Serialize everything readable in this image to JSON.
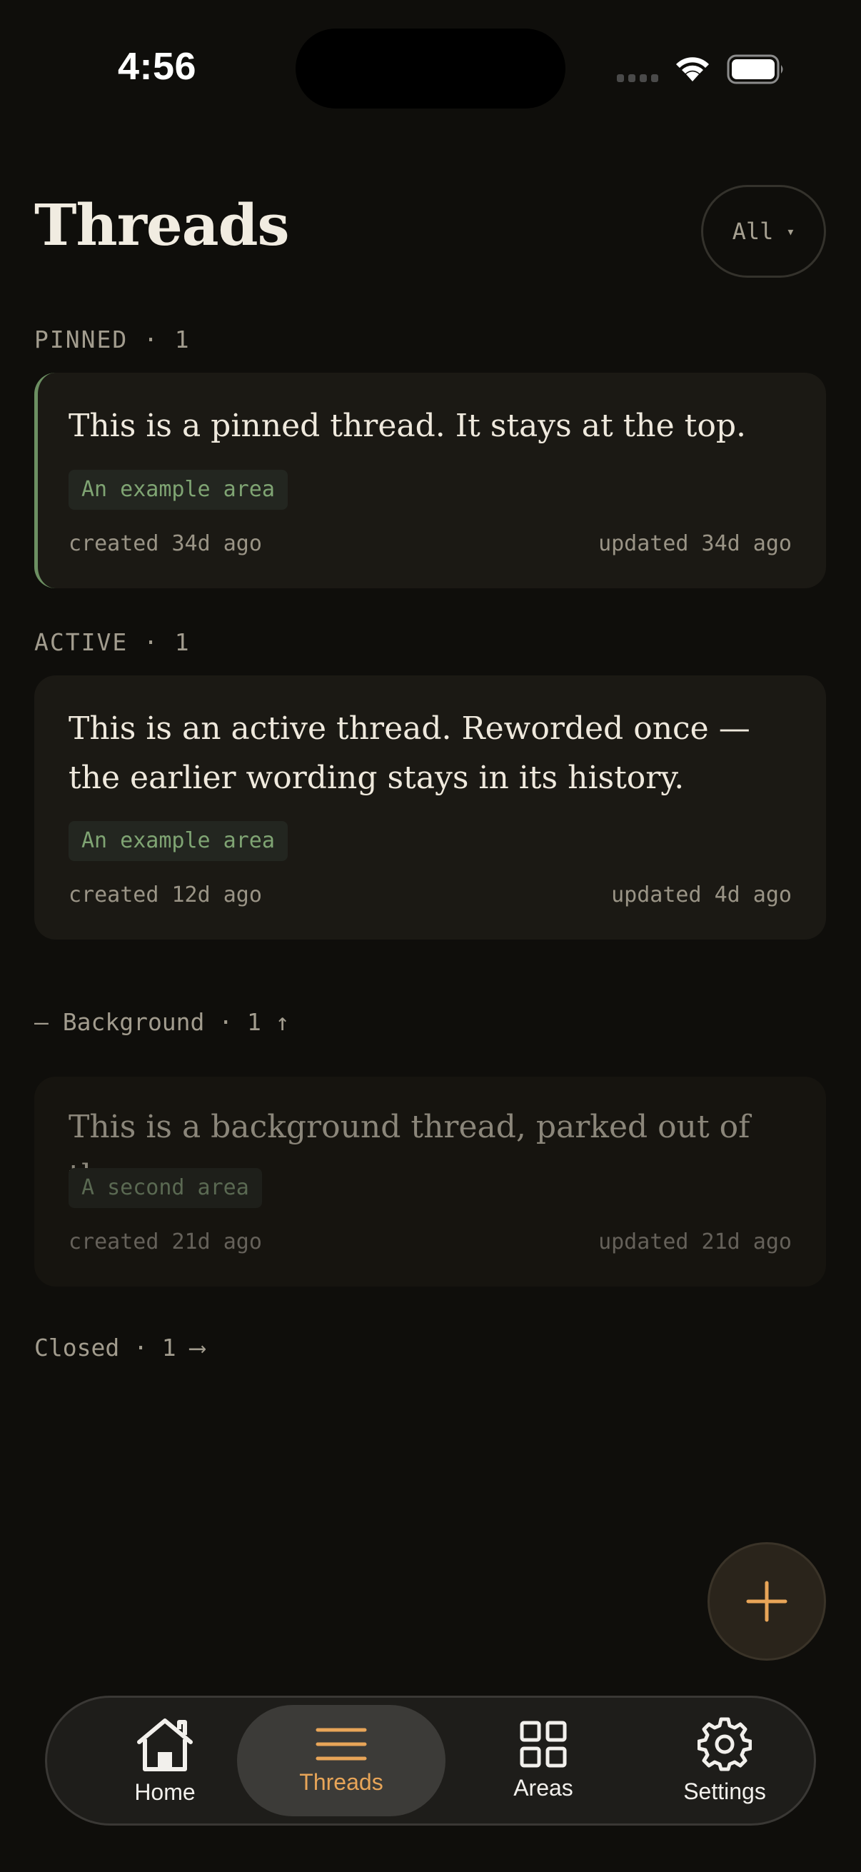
{
  "status_bar": {
    "time": "4:56"
  },
  "header": {
    "title": "Threads",
    "filter_label": "All",
    "filter_caret": "▾"
  },
  "sections": {
    "pinned": {
      "label": "PINNED · 1",
      "card": {
        "title": "This is a pinned thread. It stays at the top.",
        "tag": "An example area",
        "created": "created 34d ago",
        "updated": "updated 34d ago",
        "accent": "#6c8f62"
      }
    },
    "active": {
      "label": "ACTIVE · 1",
      "card": {
        "title_line1": "This is an active thread. Reworded once —",
        "title_line2": "the earlier wording stays in its history.",
        "tag": "An example area",
        "created": "created 12d ago",
        "updated": "updated 4d ago"
      }
    },
    "background": {
      "label": "– Background · 1 ↑",
      "card": {
        "title": "This is a background thread, parked out of the way.",
        "tag": "A second area",
        "created": "created 21d ago",
        "updated": "updated 21d ago"
      }
    },
    "closed": {
      "label": "Closed · 1 ⟶"
    }
  },
  "fab": {
    "icon": "plus-icon",
    "color": "#e8a558"
  },
  "tabbar": {
    "tabs": [
      {
        "label": "Home",
        "icon": "home-icon"
      },
      {
        "label": "Threads",
        "icon": "threads-icon",
        "active": true
      },
      {
        "label": "Areas",
        "icon": "grid-icon"
      },
      {
        "label": "Settings",
        "icon": "gear-icon"
      }
    ],
    "active_color": "#e8a558"
  }
}
